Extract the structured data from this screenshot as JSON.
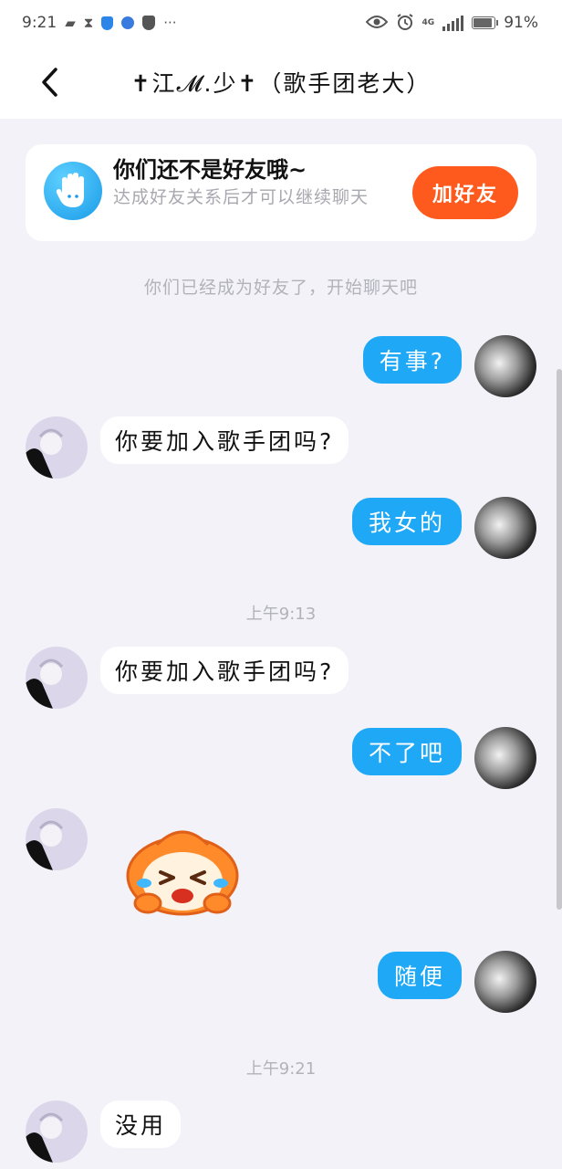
{
  "status_bar": {
    "time": "9:21",
    "network_tag": "4G",
    "battery_level": 0.91,
    "battery_text": "91%"
  },
  "header": {
    "title": "✝江𝓜.少✝（歌手团老大）"
  },
  "friend_banner": {
    "title": "你们还不是好友哦~",
    "description": "达成好友关系后才可以继续聊天",
    "add_button_label": "加好友"
  },
  "system_note": "你们已经成为好友了，开始聊天吧",
  "timestamps": [
    "上午9:13",
    "上午9:21"
  ],
  "messages": [
    {
      "sender": "me",
      "text": "有事?"
    },
    {
      "sender": "peer",
      "text": "你要加入歌手团吗?"
    },
    {
      "sender": "me",
      "text": "我女的"
    },
    {
      "sender": "peer",
      "text": "你要加入歌手团吗?"
    },
    {
      "sender": "me",
      "text": "不了吧"
    },
    {
      "sender": "peer",
      "sticker": "crying-face-sticker"
    },
    {
      "sender": "me",
      "text": "随便"
    },
    {
      "sender": "peer",
      "text": "没用"
    }
  ],
  "colors": {
    "outgoing_bubble": "#1ea8f6",
    "incoming_bubble": "#ffffff",
    "add_button": "#ff5a1e",
    "background": "#f3f2f8"
  }
}
